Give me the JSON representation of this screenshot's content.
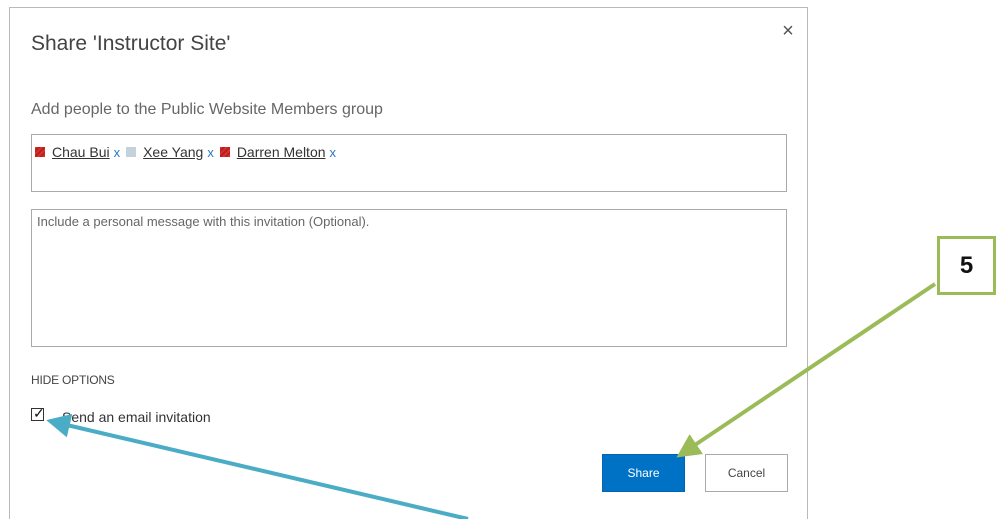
{
  "dialog": {
    "title": "Share 'Instructor Site'",
    "close_glyph": "×",
    "subtitle": "Add people to the Public Website Members group",
    "people": [
      {
        "name": "Chau Bui",
        "presence": "red",
        "remove": "x"
      },
      {
        "name": "Xee Yang",
        "presence": "gray",
        "remove": "x"
      },
      {
        "name": "Darren Melton",
        "presence": "red",
        "remove": "x"
      }
    ],
    "message_placeholder": "Include a personal message with this invitation (Optional).",
    "hide_options": "HIDE OPTIONS",
    "send_email_label": "Send an email invitation",
    "send_email_checked": true,
    "share_button": "Share",
    "cancel_button": "Cancel"
  },
  "annotation": {
    "step_number": "5",
    "step_color": "#9bbb59",
    "arrow_share_color": "#9bbb59",
    "arrow_checkbox_color": "#4bacc6"
  },
  "colors": {
    "primary_button": "#0072c6",
    "presence_busy": "#d9302c",
    "presence_offline": "#c4d2db",
    "remove_link": "#2a75c5"
  }
}
